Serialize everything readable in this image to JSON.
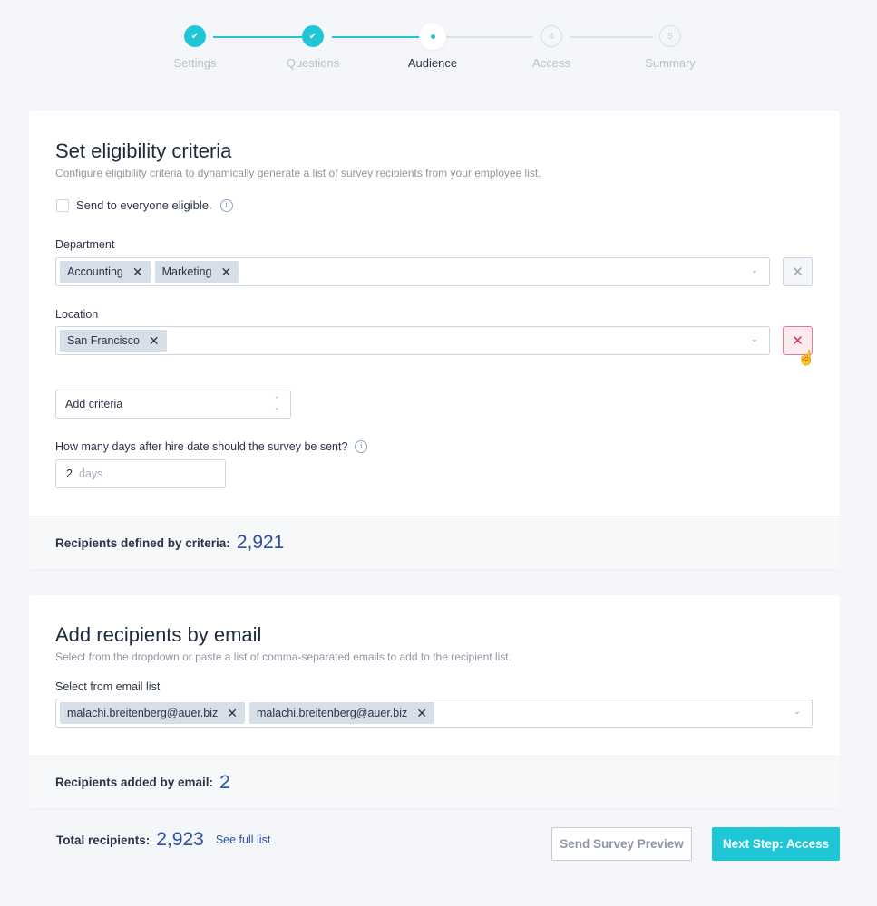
{
  "stepper": {
    "steps": [
      {
        "label": "Settings",
        "status": "done",
        "marker": "✔"
      },
      {
        "label": "Questions",
        "status": "done",
        "marker": "✔"
      },
      {
        "label": "Audience",
        "status": "active",
        "marker": ""
      },
      {
        "label": "Access",
        "status": "todo",
        "marker": "4"
      },
      {
        "label": "Summary",
        "status": "todo",
        "marker": "5"
      }
    ]
  },
  "eligibility": {
    "title": "Set eligibility criteria",
    "subtitle": "Configure eligibility criteria to dynamically generate a list of survey recipients from your employee list.",
    "send_all_label": "Send to everyone eligible.",
    "send_all_checked": false,
    "department": {
      "label": "Department",
      "tags": [
        "Accounting",
        "Marketing"
      ]
    },
    "location": {
      "label": "Location",
      "tags": [
        "San Francisco"
      ]
    },
    "add_criteria": "Add criteria",
    "days_question": "How many days after hire date should the survey be sent?",
    "days_value": "2",
    "days_unit": "days",
    "footer_label": "Recipients defined by criteria:",
    "footer_count": "2,921"
  },
  "email": {
    "title": "Add recipients by email",
    "subtitle": "Select from the dropdown or paste a list of comma-separated emails to add to the recipient list.",
    "list_label": "Select from email list",
    "tags": [
      "malachi.breitenberg@auer.biz",
      "malachi.breitenberg@auer.biz"
    ],
    "footer_label": "Recipients added by email:",
    "footer_count": "2"
  },
  "total": {
    "label": "Total recipients:",
    "count": "2,923",
    "link": "See full list"
  },
  "buttons": {
    "preview": "Send Survey Preview",
    "next": "Next Step: Access"
  },
  "icons": {
    "remove": "✕",
    "tag_remove": "✕",
    "chevron_down": "⌄",
    "info": "i",
    "updown_up": "⌃",
    "updown_down": "⌄"
  },
  "colors": {
    "accent": "#1ec6d6",
    "number": "#2c4fa3",
    "danger": "#d82f55"
  }
}
